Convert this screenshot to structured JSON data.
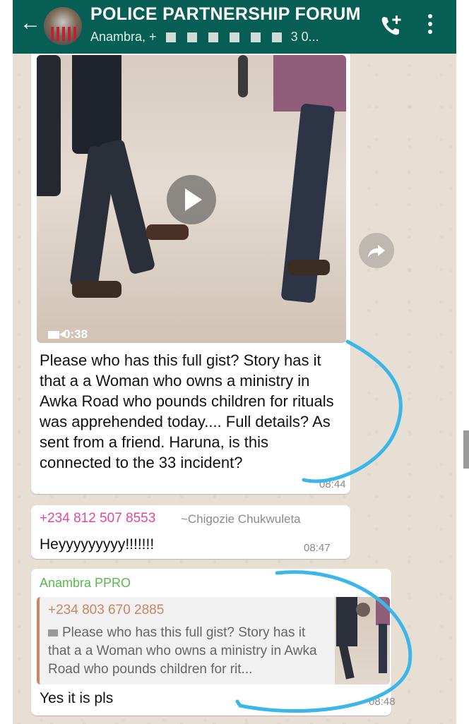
{
  "header": {
    "title": "POLICE PARTNERSHIP FORUM",
    "subtitle_start": "Anambra, +",
    "subtitle_end": "3 0...",
    "back_icon": "arrow-left-icon",
    "call_icon": "add-call-icon",
    "menu_icon": "more-vert-icon"
  },
  "messages": [
    {
      "type": "video",
      "duration": "0:38",
      "text": "Please who has this full gist? Story has it that a a Woman who owns a ministry in Awka Road who pounds children for rituals was apprehended today.... Full details? As sent from a friend. Haruna, is this connected to the 33 incident?",
      "time": "08:44"
    },
    {
      "sender": "+234 812 507 8553",
      "alias": "~Chigozie Chukwuleta",
      "text": "Heyyyyyyyyy!!!!!!!",
      "time": "08:47"
    },
    {
      "sender": "Anambra PPRO",
      "quote_sender": "+234 803 670 2885",
      "quote_text": "Please who has this full gist? Story has it that a a Woman who owns a ministry in Awka Road who pounds children for rit...",
      "text": "Yes it is pls",
      "time": "08:48"
    }
  ],
  "colors": {
    "header": "#075e54",
    "chat_bg": "#e7ded4",
    "sender_pink": "#e0499a",
    "sender_green": "#58b84d",
    "quote_accent": "#c88766",
    "annotation": "#3ab6e8"
  }
}
